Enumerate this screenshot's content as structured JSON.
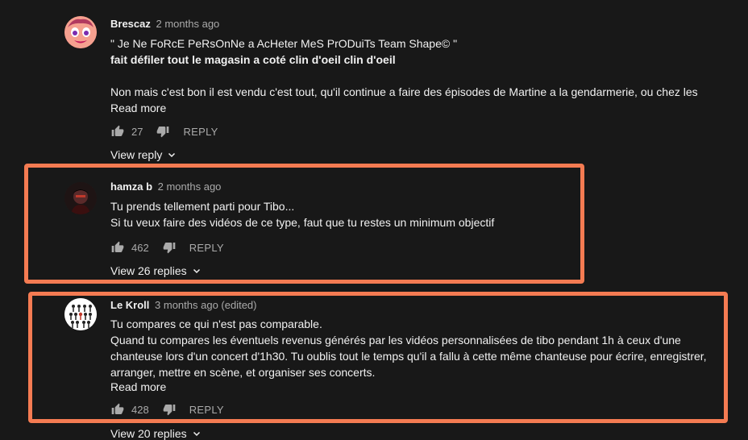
{
  "comments": [
    {
      "author": "Brescaz",
      "time": "2 months ago",
      "lines": [
        " \" Je Ne FoRcE PeRsOnNe a AcHeter MeS PrODuiTs Team Shape© \"",
        "fait défiler tout le magasin a coté clin d'oeil clin d'oeil",
        "",
        "Non mais c'est bon il est vendu c'est tout, qu'il continue a faire des épisodes de Martine a la gendarmerie, ou chez les"
      ],
      "read_more": "Read more",
      "likes": "27",
      "reply": "REPLY",
      "view_replies": "View reply"
    },
    {
      "author": "hamza b",
      "time": "2 months ago",
      "lines": [
        "Tu prends tellement parti pour Tibo...",
        "Si tu veux faire des vidéos de ce type, faut que tu restes un minimum objectif"
      ],
      "likes": "462",
      "reply": "REPLY",
      "view_replies": "View 26 replies"
    },
    {
      "author": "Le Kroll",
      "time": "3 months ago (edited)",
      "lines": [
        "Tu compares ce qui n'est pas comparable.",
        "Quand tu compares les éventuels revenus générés par les vidéos personnalisées de tibo pendant 1h à ceux d'une",
        "chanteuse lors d'un concert d'1h30. Tu oublis  tout le temps qu'il a fallu à cette même chanteuse pour écrire, enregistrer,",
        "arranger, mettre en  scène, et organiser ses concerts."
      ],
      "read_more": "Read more",
      "likes": "428",
      "reply": "REPLY",
      "view_replies": "View 20 replies"
    }
  ],
  "colors": {
    "background": "#181818",
    "highlight": "#f47b52",
    "secondary_text": "#aaaaaa"
  }
}
